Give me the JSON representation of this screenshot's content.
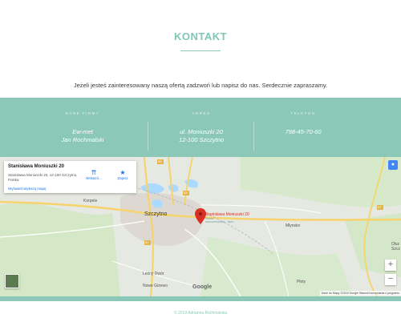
{
  "section": {
    "title": "KONTAKT",
    "intro": "Jeżeli jesteś zainteresowany naszą ofertą zadzwoń lub napisz do nas. Serdecznie zapraszamy."
  },
  "contact": {
    "firm": {
      "label": "DANE FIRMY",
      "line1": "Ew-met",
      "line2": "Jan Rochmalski"
    },
    "address": {
      "label": "ADRES",
      "line1": "ul. Moniuszki 20",
      "line2": "12-100 Szczytno"
    },
    "phone": {
      "label": "TELEFON",
      "value": "798-45-70-60"
    }
  },
  "map": {
    "card": {
      "name": "Stanisława Moniuszki 20",
      "address": "Stanisława Moniuszki 20, 12-100 Szczytno, Polska",
      "directions": "Wskazó...",
      "save": "Zapisz",
      "larger_map": "Wyświetl większą mapę"
    },
    "pin_label": "Stanisława Moniuszki 20",
    "pin_sub1": "Strefa",
    "pin_sub2": "samochodowa · Auto",
    "places": {
      "szczytno": "Szczytno",
      "korpele": "Korpele",
      "mlynsko": "Młynsko",
      "lesny_dwor": "Leśny Dwór",
      "nowe_gizewo": "Nowe Gizewo",
      "ploty": "Płoty",
      "olsz": "Olsz",
      "szcz": "Szcz"
    },
    "roads": [
      "58",
      "53",
      "57",
      "57"
    ],
    "zoom_in": "+",
    "zoom_out": "−",
    "google": "Google",
    "attribution": "Dane do Mapy ©2019 Google   Warunki korzystania z programu"
  },
  "footer": "© 2019 Adrianna Rochmalska",
  "colors": {
    "accent": "#8cc8b7",
    "title": "#7fc7b4",
    "pin": "#d93025"
  },
  "icons": {
    "directions": "directions-icon",
    "save": "star-icon",
    "pin": "map-pin-icon"
  }
}
